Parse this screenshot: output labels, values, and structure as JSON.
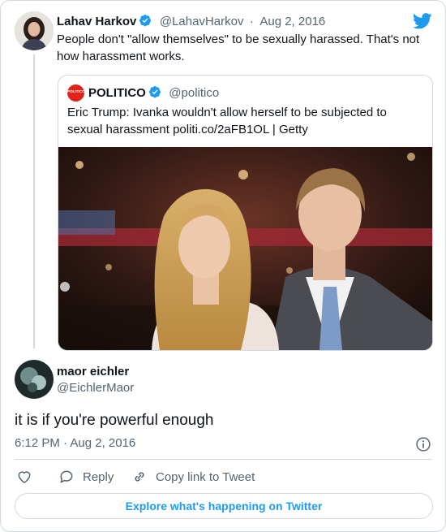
{
  "parent": {
    "name": "Lahav Harkov",
    "handle": "@LahavHarkov",
    "sep": "·",
    "date": "Aug 2, 2016",
    "text": "People don't \"allow themselves\" to be sexually harassed. That's not how harassment works."
  },
  "quoted": {
    "logo_text": "POLITICO",
    "name": "POLITICO",
    "handle": "@politico",
    "text": "Eric Trump: Ivanka wouldn't allow herself to be subjected to sexual harassment politi.co/2aFB1OL | Getty"
  },
  "reply": {
    "name": "maor eichler",
    "handle": "@EichlerMaor",
    "text": "it is if you're powerful enough",
    "time": "6:12 PM · Aug 2, 2016"
  },
  "actions": {
    "reply": "Reply",
    "copy_link": "Copy link to Tweet"
  },
  "explore": "Explore what's happening on Twitter",
  "colors": {
    "twitter_blue": "#1d9bf0",
    "politico_red": "#e2231a",
    "muted": "#536471",
    "border": "#cfd9de"
  },
  "icons": [
    "twitter-bird-icon",
    "verified-badge-icon",
    "info-icon",
    "heart-icon",
    "reply-icon",
    "copy-link-icon"
  ]
}
